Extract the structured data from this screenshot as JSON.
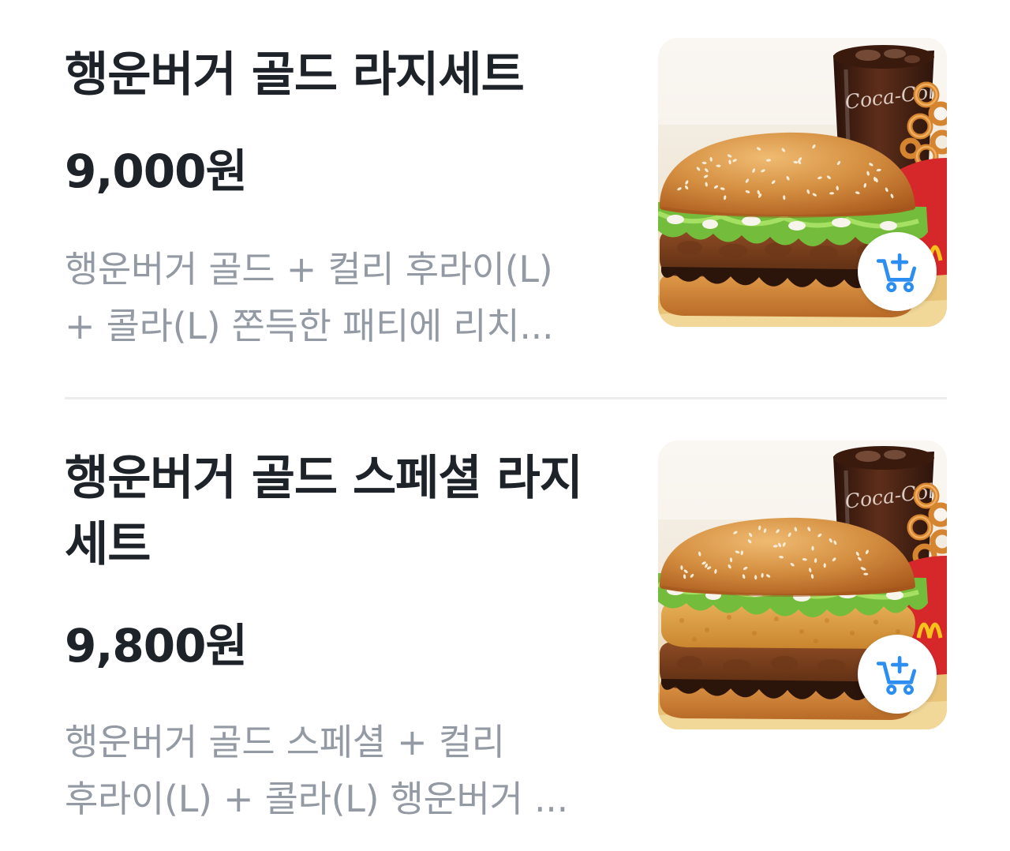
{
  "menu": {
    "items": [
      {
        "title": "행운버거 골드 라지세트",
        "price": "9,000원",
        "description_lines": [
          "행운버거 골드 + 컬리 후라이(L)",
          "+ 콜라(L) 쫀득한 패티에 리치..."
        ],
        "image": {
          "icon": "burger-set-photo",
          "cup_logo": "Coca-Col"
        },
        "cart_button": {
          "icon": "cart-plus-icon"
        }
      },
      {
        "title": "행운버거 골드 스페셜 라지세트",
        "price": "9,800원",
        "description_lines": [
          "행운버거 골드 스페셜 + 컬리",
          "후라이(L) + 콜라(L) 행운버거 ..."
        ],
        "image": {
          "icon": "burger-set-photo",
          "cup_logo": "Coca-Col"
        },
        "cart_button": {
          "icon": "cart-plus-icon"
        }
      }
    ]
  },
  "colors": {
    "background": "#ffffff",
    "text_primary": "#1e232a",
    "text_secondary": "#939aa3",
    "accent": "#2b8ef0",
    "divider": "#ececec"
  }
}
